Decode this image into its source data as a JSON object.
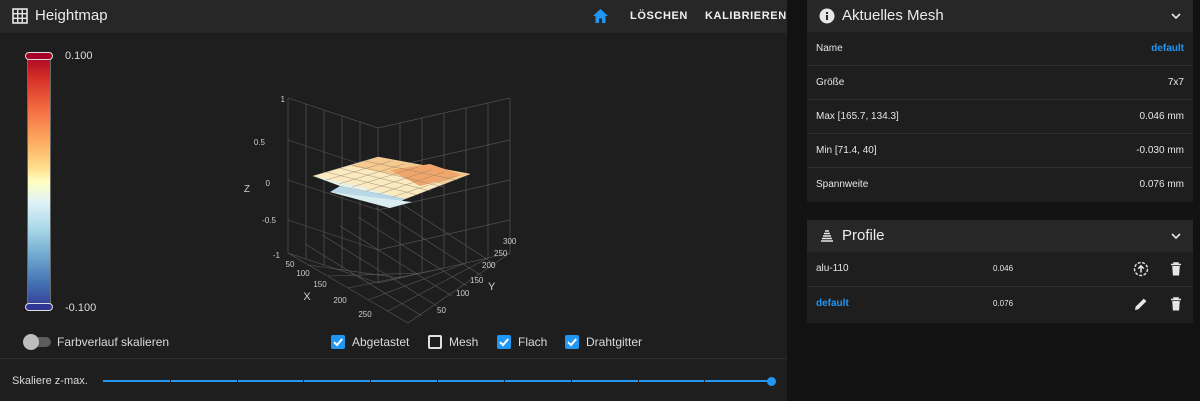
{
  "heightmap": {
    "title": "Heightmap",
    "actions": {
      "delete_label": "LÖSCHEN",
      "calibrate_label": "KALIBRIEREN"
    },
    "color_scale": {
      "max_label": "0.100",
      "min_label": "-0.100"
    },
    "plot": {
      "z_axis": {
        "label": "Z",
        "ticks": [
          "1",
          "0.5",
          "0",
          "-0.5",
          "-1"
        ]
      },
      "x_axis": {
        "label": "X",
        "ticks": [
          "50",
          "100",
          "150",
          "200",
          "250"
        ]
      },
      "y_axis": {
        "label": "Y",
        "ticks": [
          "50",
          "100",
          "150",
          "200",
          "250",
          "300"
        ]
      }
    },
    "scale_gradient_label": "Farbverlauf skalieren",
    "scale_gradient_on": false,
    "checkboxes": [
      {
        "label": "Abgetastet",
        "checked": true
      },
      {
        "label": "Mesh",
        "checked": false
      },
      {
        "label": "Flach",
        "checked": true
      },
      {
        "label": "Drahtgitter",
        "checked": true
      }
    ],
    "zmax_label": "Skaliere z-max.",
    "zmax_value": 1.0
  },
  "current_mesh": {
    "title": "Aktuelles Mesh",
    "rows": [
      {
        "key": "Name",
        "value": "default"
      },
      {
        "key": "Größe",
        "value": "7x7"
      },
      {
        "key": "Max [165.7, 134.3]",
        "value": "0.046 mm"
      },
      {
        "key": "Min [71.4, 40]",
        "value": "-0.030 mm"
      },
      {
        "key": "Spannweite",
        "value": "0.076 mm"
      }
    ]
  },
  "profiles": {
    "title": "Profile",
    "items": [
      {
        "name": "alu-110",
        "range": "0.046",
        "action_icon": "load-icon",
        "active": false
      },
      {
        "name": "default",
        "range": "0.076",
        "action_icon": "pencil-icon",
        "active": true
      }
    ]
  },
  "colors": {
    "accent": "#2196f3",
    "panel": "#1e1e1e",
    "header": "#272727",
    "background": "#121212"
  }
}
